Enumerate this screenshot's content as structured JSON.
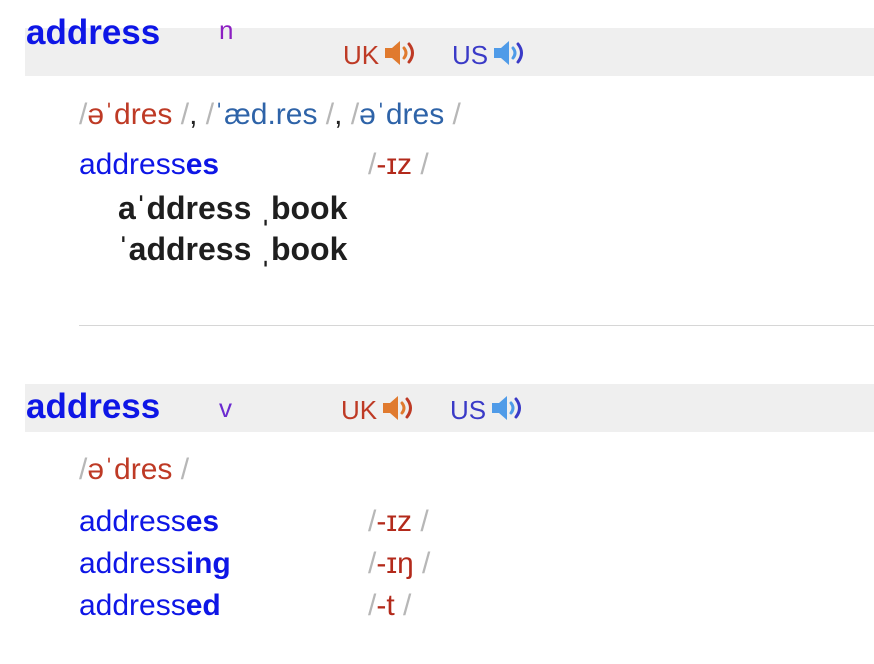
{
  "colors": {
    "headword": "#0e16e6",
    "uk": "#be3a25",
    "us": "#3a3ac7",
    "pos_noun": "#8c1fc2",
    "pos_verb": "#6b2bd0",
    "slash": "#b7b7b7",
    "header_bg": "#efefef"
  },
  "entries": [
    {
      "headword": "address",
      "pos": "n",
      "audio_uk_label": "UK",
      "audio_us_label": "US",
      "speaker_icon": "speaker-icon",
      "pron": {
        "uk": "əˈdres",
        "comma1": ",",
        "us1": "ˈæd.res",
        "comma2": ",",
        "us2": "əˈdres"
      },
      "inflections": [
        {
          "stem": "address",
          "suffix": "es",
          "ipa": "-ɪz"
        }
      ],
      "compounds": [
        "aˈddress ˌbook",
        "ˈaddress ˌbook"
      ]
    },
    {
      "headword": "address",
      "pos": "v",
      "audio_uk_label": "UK",
      "audio_us_label": "US",
      "speaker_icon": "speaker-icon",
      "pron": {
        "uk": "əˈdres"
      },
      "inflections": [
        {
          "stem": "address",
          "suffix": "es",
          "ipa": "-ɪz"
        },
        {
          "stem": "address",
          "suffix": "ing",
          "ipa": "-ɪŋ"
        },
        {
          "stem": "address",
          "suffix": "ed",
          "ipa": "-t"
        }
      ]
    }
  ]
}
